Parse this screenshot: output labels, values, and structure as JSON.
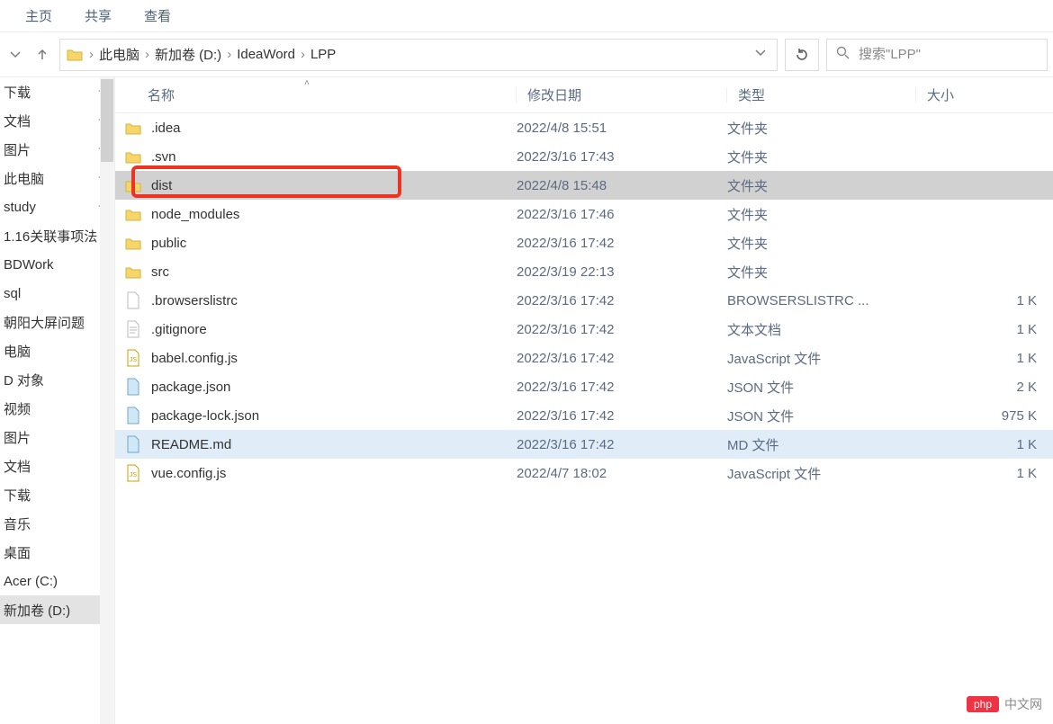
{
  "top_menu": {
    "main": "主页",
    "share": "共享",
    "view": "查看"
  },
  "breadcrumb": {
    "items": [
      "此电脑",
      "新加卷 (D:)",
      "IdeaWord",
      "LPP"
    ]
  },
  "search": {
    "placeholder": "搜索\"LPP\""
  },
  "sidebar": {
    "items": [
      {
        "label": "下载",
        "pinned": true
      },
      {
        "label": "文档",
        "pinned": true
      },
      {
        "label": "图片",
        "pinned": true
      },
      {
        "label": "此电脑",
        "pinned": true
      },
      {
        "label": "study",
        "pinned": true
      },
      {
        "label": "1.16关联事项法",
        "pinned": false
      },
      {
        "label": "BDWork",
        "pinned": false
      },
      {
        "label": "sql",
        "pinned": false
      },
      {
        "label": "朝阳大屏问题",
        "pinned": false
      },
      {
        "label": "电脑",
        "pinned": false
      },
      {
        "label": "D 对象",
        "pinned": false
      },
      {
        "label": "视频",
        "pinned": false
      },
      {
        "label": "图片",
        "pinned": false
      },
      {
        "label": "文档",
        "pinned": false
      },
      {
        "label": "下载",
        "pinned": false
      },
      {
        "label": "音乐",
        "pinned": false
      },
      {
        "label": "桌面",
        "pinned": false
      },
      {
        "label": "Acer (C:)",
        "pinned": false
      },
      {
        "label": "新加卷 (D:)",
        "pinned": false,
        "selected": true
      }
    ]
  },
  "columns": {
    "name": "名称",
    "modified": "修改日期",
    "type": "类型",
    "size": "大小"
  },
  "files": [
    {
      "name": ".idea",
      "date": "2022/4/8 15:51",
      "type": "文件夹",
      "size": "",
      "kind": "folder",
      "state": ""
    },
    {
      "name": ".svn",
      "date": "2022/3/16 17:43",
      "type": "文件夹",
      "size": "",
      "kind": "folder",
      "state": ""
    },
    {
      "name": "dist",
      "date": "2022/4/8 15:48",
      "type": "文件夹",
      "size": "",
      "kind": "folder",
      "state": "selected",
      "highlight": true
    },
    {
      "name": "node_modules",
      "date": "2022/3/16 17:46",
      "type": "文件夹",
      "size": "",
      "kind": "folder",
      "state": ""
    },
    {
      "name": "public",
      "date": "2022/3/16 17:42",
      "type": "文件夹",
      "size": "",
      "kind": "folder",
      "state": ""
    },
    {
      "name": "src",
      "date": "2022/3/19 22:13",
      "type": "文件夹",
      "size": "",
      "kind": "folder",
      "state": ""
    },
    {
      "name": ".browserslistrc",
      "date": "2022/3/16 17:42",
      "type": "BROWSERSLISTRC ...",
      "size": "1 K",
      "kind": "file",
      "state": ""
    },
    {
      "name": ".gitignore",
      "date": "2022/3/16 17:42",
      "type": "文本文档",
      "size": "1 K",
      "kind": "text",
      "state": ""
    },
    {
      "name": "babel.config.js",
      "date": "2022/3/16 17:42",
      "type": "JavaScript 文件",
      "size": "1 K",
      "kind": "js",
      "state": ""
    },
    {
      "name": "package.json",
      "date": "2022/3/16 17:42",
      "type": "JSON 文件",
      "size": "2 K",
      "kind": "json",
      "state": ""
    },
    {
      "name": "package-lock.json",
      "date": "2022/3/16 17:42",
      "type": "JSON 文件",
      "size": "975 K",
      "kind": "json",
      "state": ""
    },
    {
      "name": "README.md",
      "date": "2022/3/16 17:42",
      "type": "MD 文件",
      "size": "1 K",
      "kind": "md",
      "state": "hover"
    },
    {
      "name": "vue.config.js",
      "date": "2022/4/7 18:02",
      "type": "JavaScript 文件",
      "size": "1 K",
      "kind": "js",
      "state": ""
    }
  ],
  "watermark": {
    "badge": "php",
    "text": "中文网"
  }
}
